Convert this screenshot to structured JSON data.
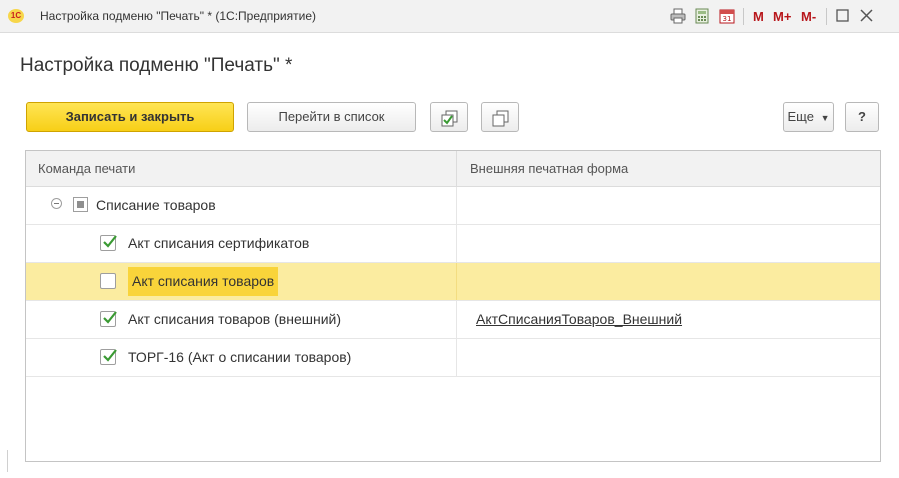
{
  "window": {
    "title": "Настройка подменю \"Печать\" * (1С:Предприятие)",
    "logo_text": "1С",
    "controls": {
      "m": "M",
      "m_plus": "M+",
      "m_minus": "M-"
    }
  },
  "form": {
    "title": "Настройка подменю \"Печать\" *"
  },
  "toolbar": {
    "save_close_label": "Записать и закрыть",
    "goto_list_label": "Перейти в список",
    "more_label": "Еще",
    "help_label": "?"
  },
  "table": {
    "columns": [
      "Команда печати",
      "Внешняя печатная форма"
    ],
    "group": {
      "label": "Списание товаров"
    },
    "rows": [
      {
        "label": "Акт списания сертификатов",
        "checked": true,
        "external": ""
      },
      {
        "label": "Акт списания товаров",
        "checked": false,
        "external": ""
      },
      {
        "label": "Акт списания товаров (внешний)",
        "checked": true,
        "external": "АктСписанияТоваров_Внешний"
      },
      {
        "label": "ТОРГ-16 (Акт о списании товаров)",
        "checked": true,
        "external": ""
      }
    ]
  },
  "colors": {
    "accent": "#f7cf17",
    "selected_row": "#fbeca0",
    "check": "#3a9a33",
    "control_red": "#b8171c"
  }
}
